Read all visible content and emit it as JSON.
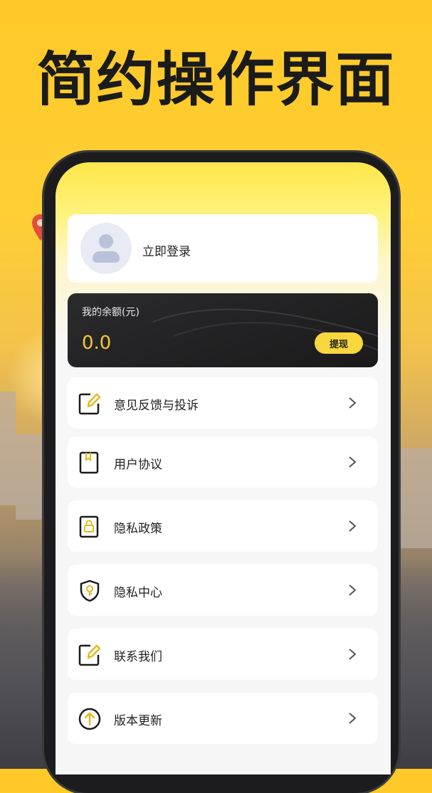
{
  "promo": {
    "headline": "简约操作界面"
  },
  "profile": {
    "login_label": "立即登录",
    "avatar_icon": "user-avatar-icon"
  },
  "balance": {
    "label": "我的余额(元)",
    "value": "0.0",
    "withdraw_label": "提现"
  },
  "menu": [
    {
      "label": "意见反馈与投诉",
      "icon": "edit-note-icon"
    },
    {
      "label": "用户协议",
      "icon": "book-icon"
    },
    {
      "label": "隐私政策",
      "icon": "lock-icon"
    },
    {
      "label": "隐私中心",
      "icon": "shield-key-icon"
    },
    {
      "label": "联系我们",
      "icon": "edit-note-icon"
    },
    {
      "label": "版本更新",
      "icon": "arrow-up-circle-icon"
    }
  ],
  "colors": {
    "accent": "#f8d63e",
    "balance_text": "#f7c63c",
    "card_dark": "#1a1a1b"
  }
}
